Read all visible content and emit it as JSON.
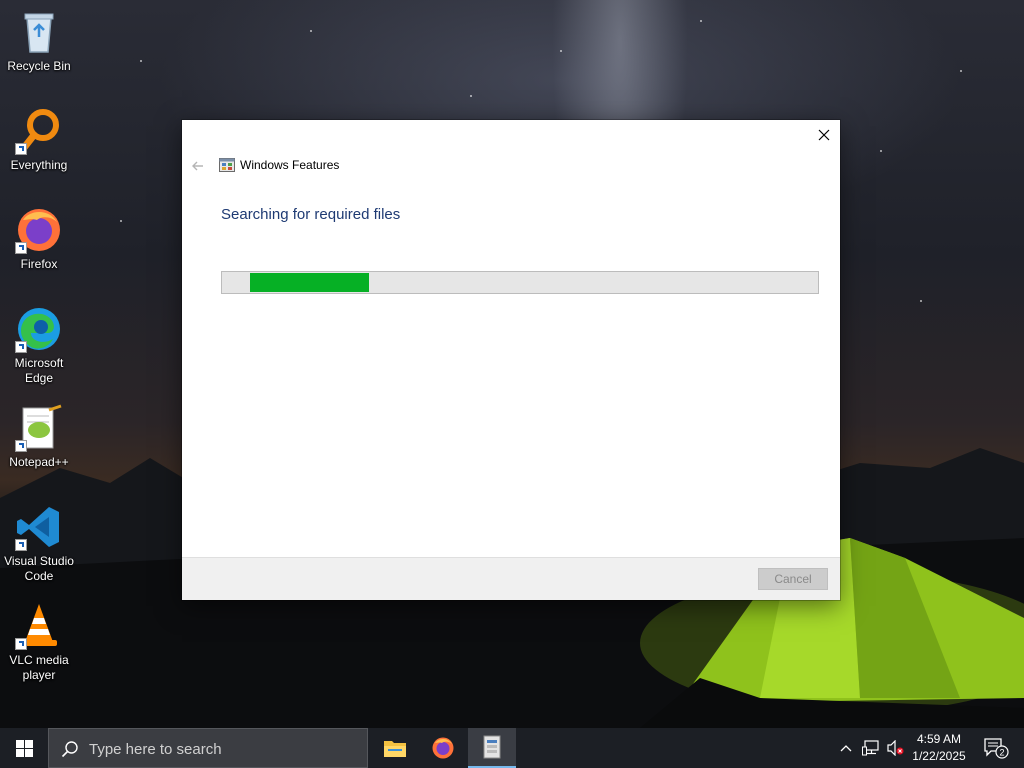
{
  "desktop": {
    "icons": [
      {
        "label": "Recycle Bin",
        "icon": "recycle-bin-icon"
      },
      {
        "label": "Everything",
        "icon": "everything-search-icon"
      },
      {
        "label": "Firefox",
        "icon": "firefox-icon"
      },
      {
        "label": "Microsoft Edge",
        "icon": "edge-icon"
      },
      {
        "label": "Notepad++",
        "icon": "notepad-plus-plus-icon"
      },
      {
        "label": "Visual Studio Code",
        "icon": "vscode-icon"
      },
      {
        "label": "VLC media player",
        "icon": "vlc-icon"
      }
    ]
  },
  "dialog": {
    "title": "Windows Features",
    "status": "Searching for required files",
    "progress_percent": 21,
    "cancel_label": "Cancel",
    "cancel_enabled": false,
    "progress_color": "#06b025",
    "heading_color": "#1e3a73"
  },
  "taskbar": {
    "search_placeholder": "Type here to search",
    "apps": [
      {
        "name": "file-explorer",
        "active": false
      },
      {
        "name": "firefox",
        "active": false
      },
      {
        "name": "windows-features",
        "active": true
      }
    ],
    "time": "4:59 AM",
    "date": "1/22/2025",
    "notification_count": "2"
  }
}
